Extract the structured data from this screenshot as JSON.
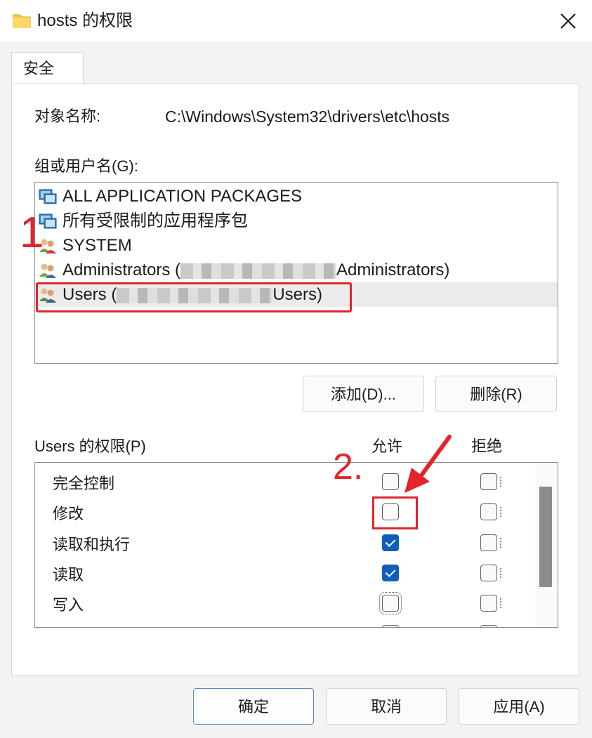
{
  "window": {
    "title": "hosts 的权限",
    "close_label": "close"
  },
  "tab": {
    "label": "安全"
  },
  "object": {
    "label": "对象名称:",
    "value": "C:\\Windows\\System32\\drivers\\etc\\hosts"
  },
  "groups": {
    "label": "组或用户名(G):",
    "items": [
      {
        "name": "ALL APPLICATION PACKAGES",
        "icon": "app-packages-icon"
      },
      {
        "name": "所有受限制的应用程序包",
        "icon": "app-packages-icon"
      },
      {
        "name": "SYSTEM",
        "icon": "users-group-icon"
      },
      {
        "prefix": "Administrators (",
        "suffix": "Administrators)",
        "icon": "users-group-icon"
      },
      {
        "prefix": "Users (",
        "suffix": "Users)",
        "icon": "users-group-icon",
        "selected": true
      }
    ]
  },
  "buttons": {
    "add": "添加(D)...",
    "remove": "删除(R)",
    "ok": "确定",
    "cancel": "取消",
    "apply": "应用(A)"
  },
  "permissions": {
    "label": "Users 的权限(P)",
    "allow_header": "允许",
    "deny_header": "拒绝",
    "rows": [
      {
        "name": "完全控制",
        "allow": false,
        "deny": false
      },
      {
        "name": "修改",
        "allow": false,
        "deny": false
      },
      {
        "name": "读取和执行",
        "allow": true,
        "deny": false
      },
      {
        "name": "读取",
        "allow": true,
        "deny": false
      },
      {
        "name": "写入",
        "allow": false,
        "deny": false
      }
    ]
  },
  "annotations": {
    "step1": "1",
    "step2": "2.",
    "color": "#e0252b"
  },
  "colors": {
    "checkbox_checked": "#0f5fb8",
    "annotation": "#e0252b"
  }
}
